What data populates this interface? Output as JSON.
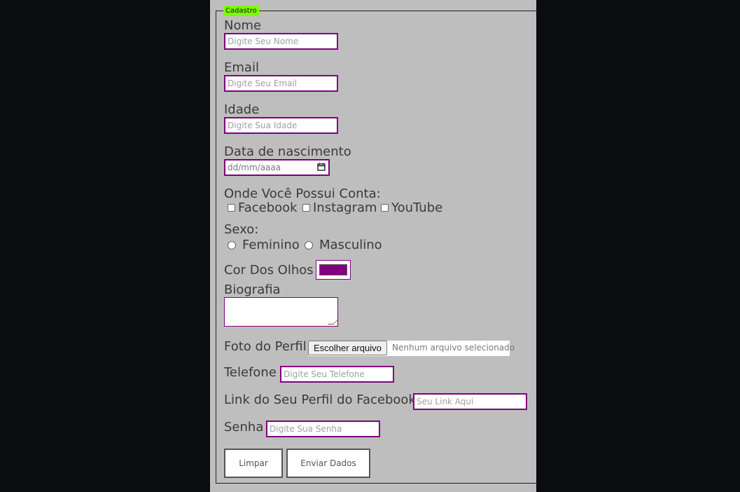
{
  "form": {
    "legend": "Cadastro",
    "name": {
      "label": "Nome",
      "placeholder": "Digite Seu Nome"
    },
    "email": {
      "label": "Email",
      "placeholder": "Digite Seu Email"
    },
    "age": {
      "label": "Idade",
      "placeholder": "Digite Sua Idade"
    },
    "birth": {
      "label": "Data de nascimento",
      "placeholder": "dd/mm/aaaa"
    },
    "accounts": {
      "label": "Onde Você Possui Conta:",
      "options": [
        "Facebook",
        "Instagram",
        "YouTube"
      ]
    },
    "sex": {
      "label": "Sexo:",
      "options": [
        "Feminino",
        "Masculino"
      ]
    },
    "eye_color": {
      "label": "Cor Dos Olhos",
      "value": "#800080"
    },
    "bio": {
      "label": "Biografia"
    },
    "photo": {
      "label": "Foto do Perfil",
      "button": "Escolher arquivo",
      "status": "Nenhum arquivo selecionado"
    },
    "phone": {
      "label": "Telefone",
      "placeholder": "Digite Seu Telefone"
    },
    "facebook_link": {
      "label": "Link do Seu Perfil do Facebook",
      "placeholder": "Seu Link Aqui"
    },
    "password": {
      "label": "Senha",
      "placeholder": "Digite Sua Senha"
    },
    "buttons": {
      "clear": "Limpar",
      "submit": "Enviar Dados"
    }
  },
  "colors": {
    "accent": "#800080",
    "legend_bg": "#7cfc00",
    "panel_bg": "#bebebe",
    "page_bg": "#0b0c10"
  }
}
